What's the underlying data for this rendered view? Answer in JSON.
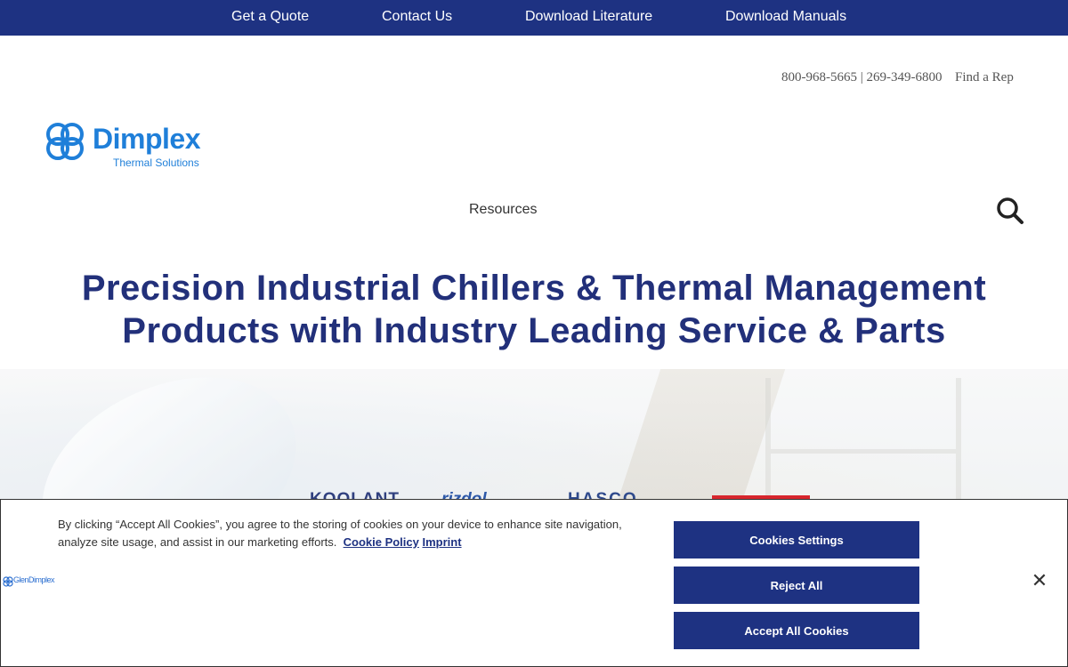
{
  "topbar": {
    "links": [
      "Get a Quote",
      "Contact Us",
      "Download Literature",
      "Download Manuals"
    ],
    "background": "#1e3282"
  },
  "header": {
    "phone_1": "800-968-5665",
    "separator": "|",
    "phone_2": "269-349-6800",
    "find_rep": "Find a Rep"
  },
  "logo": {
    "name": "Dimplex",
    "tagline": "Thermal Solutions",
    "color": "#1f7fd9"
  },
  "nav": {
    "resources": "Resources",
    "search_icon": "search-icon"
  },
  "hero": {
    "headline_line1": "Precision Industrial Chillers & Thermal Management",
    "headline_line2": "Products with Industry Leading Service & Parts",
    "headline_color": "#22307a",
    "brand_logos": [
      "KOOLANT",
      "rizdol",
      "HASCO"
    ]
  },
  "cookie_banner": {
    "message": "By clicking “Accept All Cookies”, you agree to the storing of cookies on your device to enhance site navigation, analyze site usage, and assist in our marketing efforts.",
    "policy_link": "Cookie Policy",
    "imprint_link": "Imprint",
    "company_logo": "GlenDimplex",
    "settings_button": "Cookies Settings",
    "reject_button": "Reject All",
    "accept_button": "Accept All Cookies",
    "close_icon": "close-icon",
    "button_color": "#1e3282"
  }
}
